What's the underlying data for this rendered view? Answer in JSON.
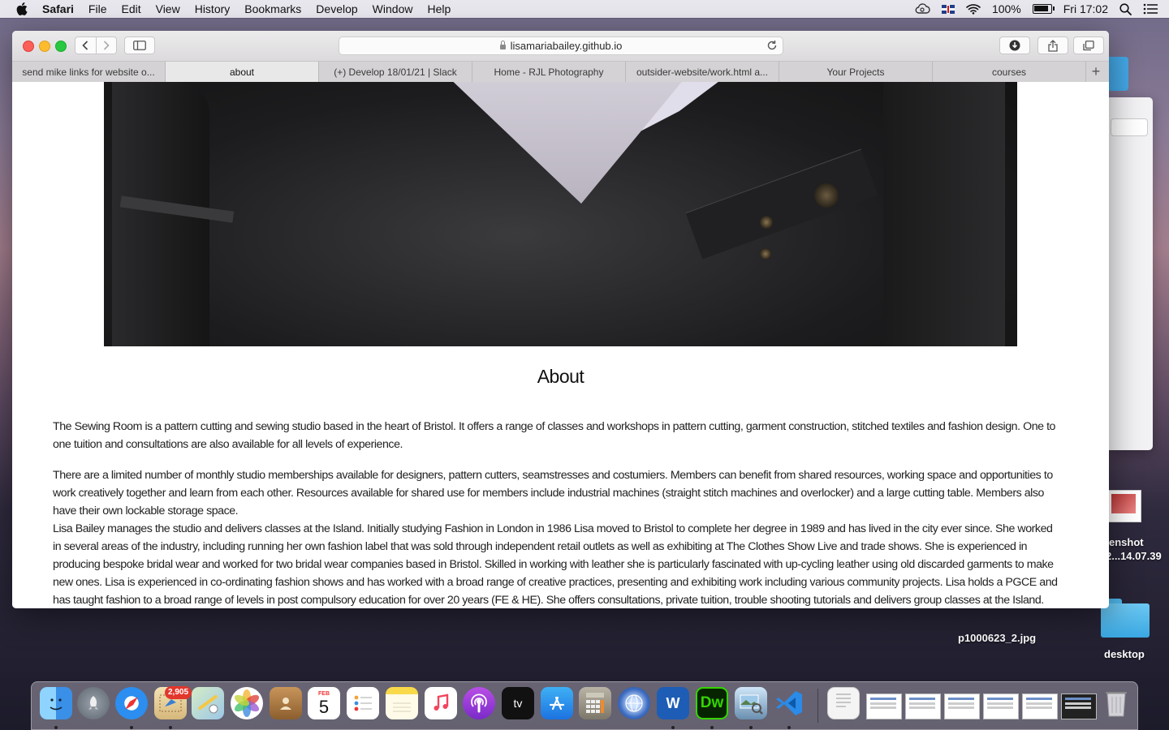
{
  "menubar": {
    "app": "Safari",
    "items": [
      "File",
      "Edit",
      "View",
      "History",
      "Bookmarks",
      "Develop",
      "Window",
      "Help"
    ],
    "battery": "100%",
    "battery_level": 1.0,
    "clock": "Fri 17:02"
  },
  "browser": {
    "url": "lisamariabailey.github.io",
    "tabs": [
      {
        "label": "send mike links for website o..."
      },
      {
        "label": "about"
      },
      {
        "label": "(+) Develop 18/01/21 | Slack"
      },
      {
        "label": "Home - RJL Photography"
      },
      {
        "label": "outsider-website/work.html a..."
      },
      {
        "label": "Your Projects"
      },
      {
        "label": "courses"
      }
    ],
    "new_tab": "+"
  },
  "page": {
    "title": "About",
    "paragraphs": [
      "The Sewing Room is a pattern cutting and sewing studio based in the heart of Bristol. It offers a range of classes and workshops in pattern cutting, garment construction, stitched textiles and fashion design. One to one tuition and consultations are also available for all levels of experience.",
      "There are a limited number of monthly studio memberships available for designers, pattern cutters, seamstresses and costumiers. Members can benefit from shared resources, working space and opportunities to work creatively together and learn from each other. Resources available for shared use for members include industrial machines (straight stitch machines and overlocker) and a large cutting table. Members also have their own lockable storage space.",
      "Lisa Bailey manages the studio and delivers classes at the Island. Initially studying Fashion in London in 1986 Lisa moved to Bristol to complete her degree in 1989 and has lived in the city ever since. She worked in several areas of the industry, including running her own fashion label that was sold through independent retail outlets as well as exhibiting at The Clothes Show Live and trade shows. She is experienced in producing bespoke bridal wear and worked for two bridal wear companies based in Bristol. Skilled in working with leather she is particularly fascinated with up-cycling leather using old discarded garments to make new ones. Lisa is experienced in co-ordinating fashion shows and has worked with a broad range of creative practices, presenting and exhibiting work including various community projects. Lisa holds a PGCE and has taught fashion to a broad range of levels in post compulsory education for over 20 years (FE & HE). She offers consultations, private tuition, trouble shooting tutorials and delivers group classes at the Island."
    ]
  },
  "desktop": {
    "screenshot_label_1": "enshot",
    "screenshot_label_2": "2...14.07.39",
    "file_label": "p1000623_2.jpg",
    "folder_label": "desktop"
  },
  "dock": {
    "mail_badge": "2,905",
    "calendar_month": "FEB",
    "calendar_day": "5",
    "dreamweaver": "Dw",
    "word": "W",
    "tv": "tv"
  }
}
